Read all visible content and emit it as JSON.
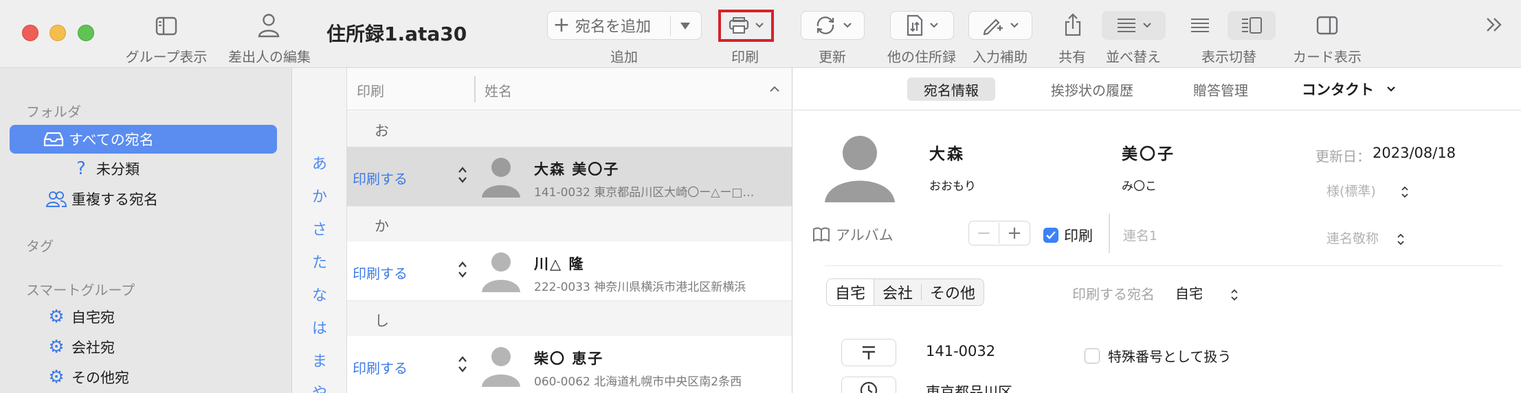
{
  "window": {
    "title": "住所録1.ata30"
  },
  "toolbar": {
    "group_view_label": "グループ表示",
    "sender_edit_label": "差出人の編集",
    "add_button_label": "宛名を追加",
    "add_label": "追加",
    "print_label": "印刷",
    "update_label": "更新",
    "other_address_label": "他の住所録",
    "input_assist_label": "入力補助",
    "share_label": "共有",
    "sort_label": "並べ替え",
    "view_switch_label": "表示切替",
    "card_view_label": "カード表示",
    "highlight_color": "#d5222b"
  },
  "sidebar": {
    "folder_header": "フォルダ",
    "all_label": "すべての宛名",
    "uncategorized_label": "未分類",
    "duplicates_label": "重複する宛名",
    "tag_header": "タグ",
    "smart_group_header": "スマートグループ",
    "smart_groups": [
      "自宅宛",
      "会社宛",
      "その他宛"
    ],
    "selection_color": "#5b8cf0"
  },
  "index": {
    "letters": [
      "あ",
      "か",
      "さ",
      "た",
      "な",
      "は",
      "ま",
      "や"
    ]
  },
  "list": {
    "header_print": "印刷",
    "header_name": "姓名",
    "groups": [
      {
        "label": "お",
        "rows": [
          {
            "print": "印刷する",
            "name": "大森 美〇子",
            "address": "141-0032 東京都品川区大崎〇ー△ー□…"
          }
        ]
      },
      {
        "label": "か",
        "rows": [
          {
            "print": "印刷する",
            "name": "川△ 隆",
            "address": "222-0033 神奈川県横浜市港北区新横浜"
          }
        ]
      },
      {
        "label": "し",
        "rows": [
          {
            "print": "印刷する",
            "name": "柴〇 恵子",
            "address": "060-0062 北海道札幌市中央区南2条西"
          }
        ]
      }
    ]
  },
  "detail": {
    "tabs": [
      "宛名情報",
      "挨拶状の履歴",
      "贈答管理",
      "コンタクト"
    ],
    "surname": "大森",
    "given_name": "美〇子",
    "surname_kana": "おおもり",
    "given_kana": "み〇こ",
    "updated_label": "更新日：",
    "updated_value": "2023/08/18",
    "honorific_placeholder": "様(標準)",
    "album_label": "アルバム",
    "print_checkbox_label": "印刷",
    "joint_name_placeholder": "連名1",
    "joint_honorific_placeholder": "連名敬称",
    "address_tabs": [
      "自宅",
      "会社",
      "その他"
    ],
    "print_address_label": "印刷する宛名",
    "print_address_value": "自宅",
    "postal_code": "141-0032",
    "special_number_label": "特殊番号として扱う",
    "address_line1": "東京都品川区"
  }
}
